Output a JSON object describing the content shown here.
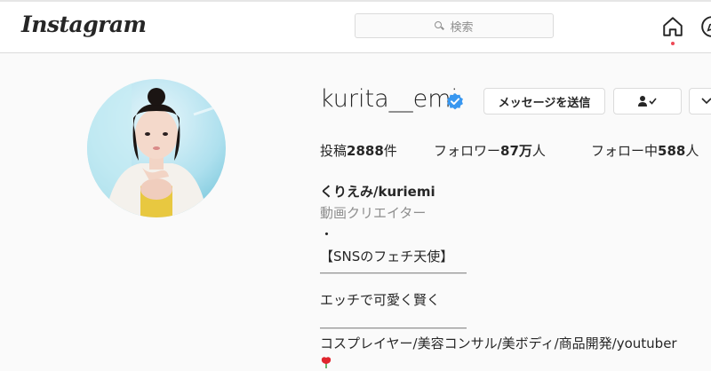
{
  "header": {
    "logo": "Instagram",
    "search_placeholder": "検索"
  },
  "profile": {
    "username": "kurita__emi",
    "verified": true,
    "buttons": {
      "message": "メッセージを送信"
    },
    "stats": {
      "posts_label": "投稿",
      "posts_value": "2888",
      "posts_unit": "件",
      "followers_label": "フォロワー",
      "followers_value": "87万",
      "followers_unit": "人",
      "following_label": "フォロー中",
      "following_value": "588",
      "following_unit": "人"
    },
    "bio": {
      "name": "くりえみ/kuriemi",
      "category": "動画クリエイター",
      "lines": [
        "・",
        "【SNSのフェチ天使】",
        "＿＿＿＿＿＿＿＿＿＿＿",
        "エッチで可愛く賢く",
        "＿＿＿＿＿＿＿＿＿＿＿",
        "コスプレイヤー/美容コンサル/美ボディ/商品開発/youtuber"
      ]
    }
  },
  "colors": {
    "accent_blue": "#3897f0",
    "notification_red": "#ed4956",
    "border": "#dbdbdb",
    "secondary_text": "#8e8e8e"
  }
}
